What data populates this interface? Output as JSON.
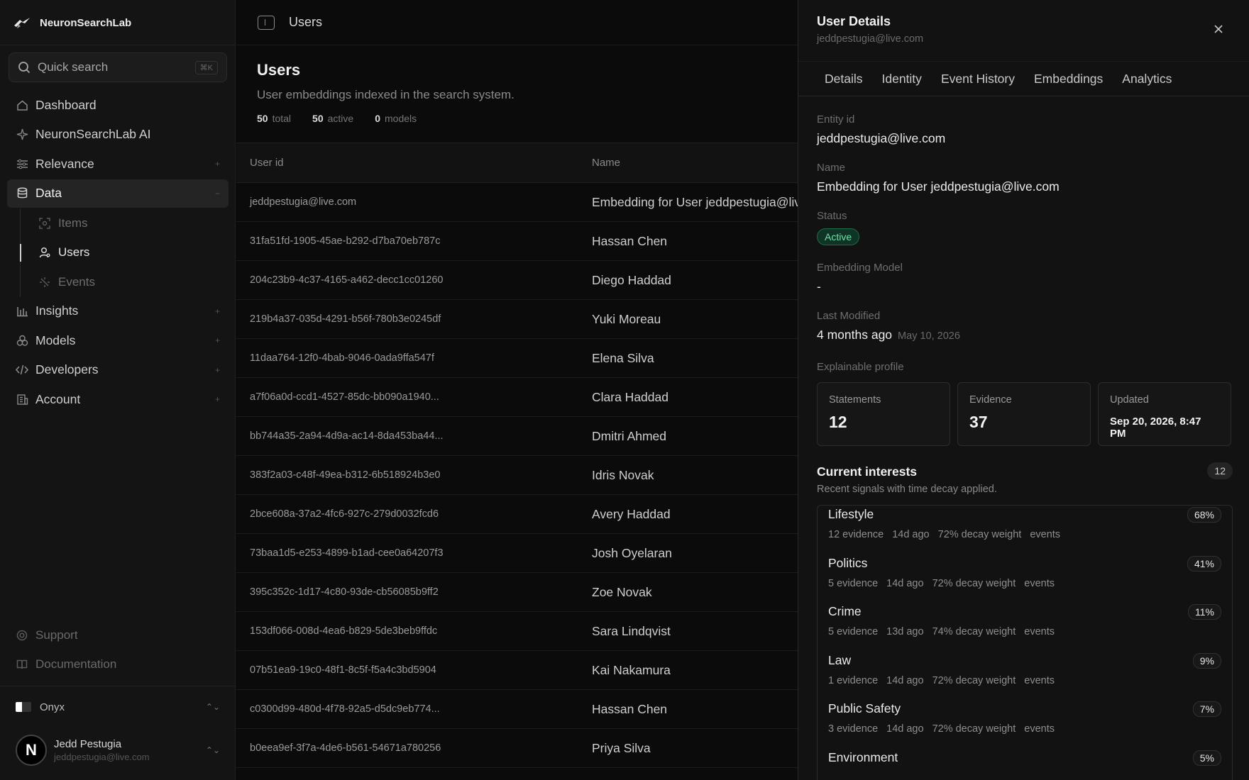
{
  "app": {
    "name": "NeuronSearchLab"
  },
  "search": {
    "placeholder": "Quick search",
    "shortcut": "⌘K"
  },
  "sidebar": {
    "items": [
      {
        "label": "Dashboard",
        "icon": "home-icon"
      },
      {
        "label": "NeuronSearchLab AI",
        "icon": "sparkle-icon"
      },
      {
        "label": "Relevance",
        "icon": "sliders-icon"
      },
      {
        "label": "Data",
        "icon": "database-icon"
      },
      {
        "label": "Insights",
        "icon": "bar-chart-icon"
      },
      {
        "label": "Models",
        "icon": "cubes-icon"
      },
      {
        "label": "Developers",
        "icon": "code-icon"
      },
      {
        "label": "Account",
        "icon": "building-icon"
      }
    ],
    "data_subitems": [
      {
        "label": "Items",
        "icon": "scan-icon"
      },
      {
        "label": "Users",
        "icon": "user-icon"
      },
      {
        "label": "Events",
        "icon": "event-icon"
      }
    ],
    "bottom": [
      {
        "label": "Support",
        "icon": "lifebuoy-icon"
      },
      {
        "label": "Documentation",
        "icon": "book-icon"
      }
    ],
    "workspace": "Onyx",
    "user": {
      "initial": "N",
      "name": "Jedd Pestugia",
      "email": "jeddpestugia@live.com"
    }
  },
  "topbar": {
    "crumb": "Users"
  },
  "page": {
    "title": "Users",
    "subtitle": "User embeddings indexed in the search system.",
    "stats": [
      {
        "value": "50",
        "label": "total"
      },
      {
        "value": "50",
        "label": "active"
      },
      {
        "value": "0",
        "label": "models"
      }
    ]
  },
  "table": {
    "columns": [
      "User id",
      "Name"
    ],
    "rows": [
      {
        "id": "jeddpestugia@live.com",
        "name": "Embedding for User jeddpestugia@live.com"
      },
      {
        "id": "31fa51fd-1905-45ae-b292-d7ba70eb787c",
        "name": "Hassan Chen"
      },
      {
        "id": "204c23b9-4c37-4165-a462-decc1cc01260",
        "name": "Diego Haddad"
      },
      {
        "id": "219b4a37-035d-4291-b56f-780b3e0245df",
        "name": "Yuki Moreau"
      },
      {
        "id": "11daa764-12f0-4bab-9046-0ada9ffa547f",
        "name": "Elena Silva"
      },
      {
        "id": "a7f06a0d-ccd1-4527-85dc-bb090a1940...",
        "name": "Clara Haddad"
      },
      {
        "id": "bb744a35-2a94-4d9a-ac14-8da453ba44...",
        "name": "Dmitri Ahmed"
      },
      {
        "id": "383f2a03-c48f-49ea-b312-6b518924b3e0",
        "name": "Idris Novak"
      },
      {
        "id": "2bce608a-37a2-4fc6-927c-279d0032fcd6",
        "name": "Avery Haddad"
      },
      {
        "id": "73baa1d5-e253-4899-b1ad-cee0a64207f3",
        "name": "Josh Oyelaran"
      },
      {
        "id": "395c352c-1d17-4c80-93de-cb56085b9ff2",
        "name": "Zoe Novak"
      },
      {
        "id": "153df066-008d-4ea6-b829-5de3beb9ffdc",
        "name": "Sara Lindqvist"
      },
      {
        "id": "07b51ea9-19c0-48f1-8c5f-f5a4c3bd5904",
        "name": "Kai Nakamura"
      },
      {
        "id": "c0300d99-480d-4f78-92a5-d5dc9eb774...",
        "name": "Hassan Chen"
      },
      {
        "id": "b0eea9ef-3f7a-4de6-b561-54671a780256",
        "name": "Priya Silva"
      }
    ]
  },
  "drawer": {
    "title": "User Details",
    "subtitle": "jeddpestugia@live.com",
    "tabs": [
      "Details",
      "Identity",
      "Event History",
      "Embeddings",
      "Analytics"
    ],
    "fields": {
      "entity_label": "Entity id",
      "entity_value": "jeddpestugia@live.com",
      "name_label": "Name",
      "name_value": "Embedding for User jeddpestugia@live.com",
      "status_label": "Status",
      "status_value": "Active",
      "model_label": "Embedding Model",
      "model_value": "-",
      "modified_label": "Last Modified",
      "modified_value": "4 months ago",
      "modified_date": "May 10, 2026",
      "profile_label": "Explainable profile"
    },
    "cards": [
      {
        "label": "Statements",
        "value": "12"
      },
      {
        "label": "Evidence",
        "value": "37"
      },
      {
        "label": "Updated",
        "value": "Sep 20, 2026, 8:47 PM"
      }
    ],
    "interests": {
      "title": "Current interests",
      "subtitle": "Recent signals with time decay applied.",
      "count": "12",
      "items": [
        {
          "name": "Lifestyle",
          "pct": "68%",
          "evidence": "12 evidence",
          "age": "14d ago",
          "decay": "72% decay weight",
          "source": "events"
        },
        {
          "name": "Politics",
          "pct": "41%",
          "evidence": "5 evidence",
          "age": "14d ago",
          "decay": "72% decay weight",
          "source": "events"
        },
        {
          "name": "Crime",
          "pct": "11%",
          "evidence": "5 evidence",
          "age": "13d ago",
          "decay": "74% decay weight",
          "source": "events"
        },
        {
          "name": "Law",
          "pct": "9%",
          "evidence": "1 evidence",
          "age": "14d ago",
          "decay": "72% decay weight",
          "source": "events"
        },
        {
          "name": "Public Safety",
          "pct": "7%",
          "evidence": "3 evidence",
          "age": "14d ago",
          "decay": "72% decay weight",
          "source": "events"
        },
        {
          "name": "Environment",
          "pct": "5%",
          "evidence": "",
          "age": "",
          "decay": "",
          "source": ""
        }
      ]
    }
  }
}
